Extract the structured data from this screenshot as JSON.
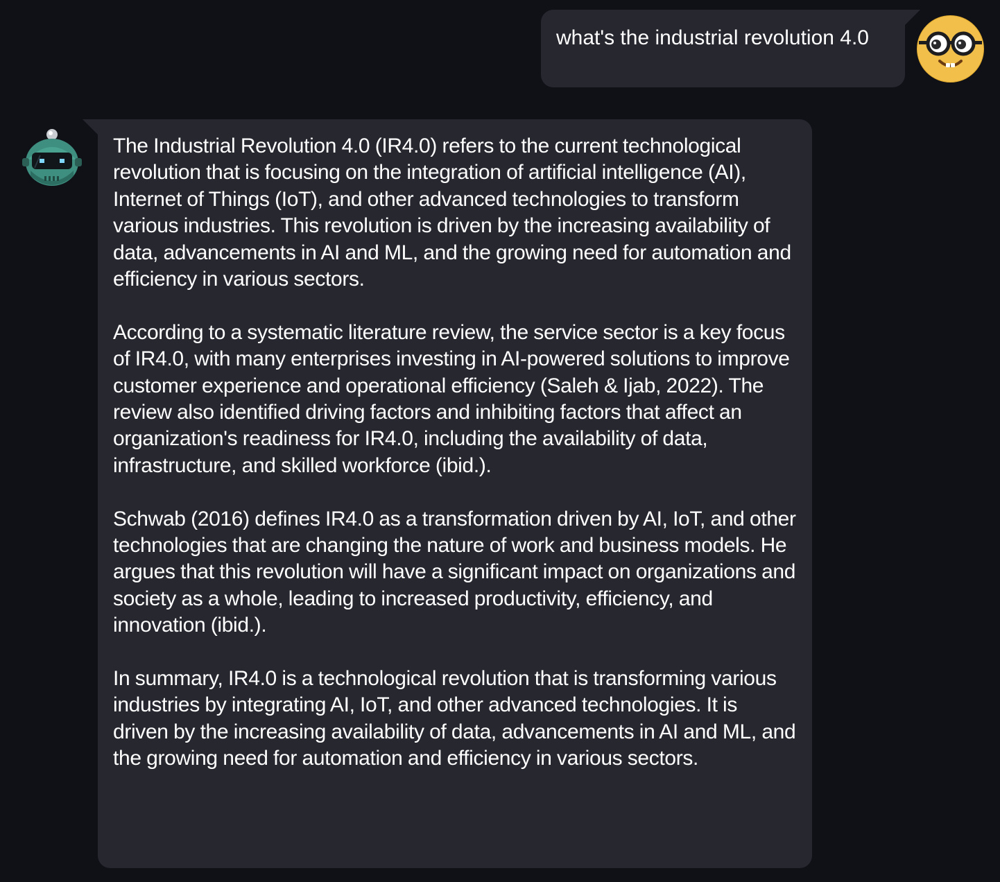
{
  "conversation": {
    "user_message": {
      "text": "what's the industrial revolution 4.0",
      "avatar": "nerd-face-emoji-icon"
    },
    "bot_message": {
      "avatar": "robot-icon",
      "paragraphs": [
        "The Industrial Revolution 4.0 (IR4.0) refers to the current technological revolution that is focusing on the integration of artificial intelligence (AI), Internet of Things (IoT), and other advanced technologies to transform various industries. This revolution is driven by the increasing availability of data, advancements in AI and ML, and the growing need for automation and efficiency in various sectors.",
        "According to a systematic literature review, the service sector is a key focus of IR4.0, with many enterprises investing in AI-powered solutions to improve customer experience and operational efficiency (Saleh & Ijab, 2022). The review also identified driving factors and inhibiting factors that affect an organization's readiness for IR4.0, including the availability of data, infrastructure, and skilled workforce (ibid.).",
        "Schwab (2016) defines IR4.0 as a transformation driven by AI, IoT, and other technologies that are changing the nature of work and business models. He argues that this revolution will have a significant impact on organizations and society as a whole, leading to increased productivity, efficiency, and innovation (ibid.).",
        "In summary, IR4.0 is a technological revolution that is transforming various industries by integrating AI, IoT, and other advanced technologies. It is driven by the increasing availability of data, advancements in AI and ML, and the growing need for automation and efficiency in various sectors."
      ]
    }
  },
  "colors": {
    "background": "#0f1117",
    "bubble": "#272730",
    "text": "#ffffff",
    "user_avatar": "#f2c04a",
    "bot_avatar": "#3f8f80"
  }
}
